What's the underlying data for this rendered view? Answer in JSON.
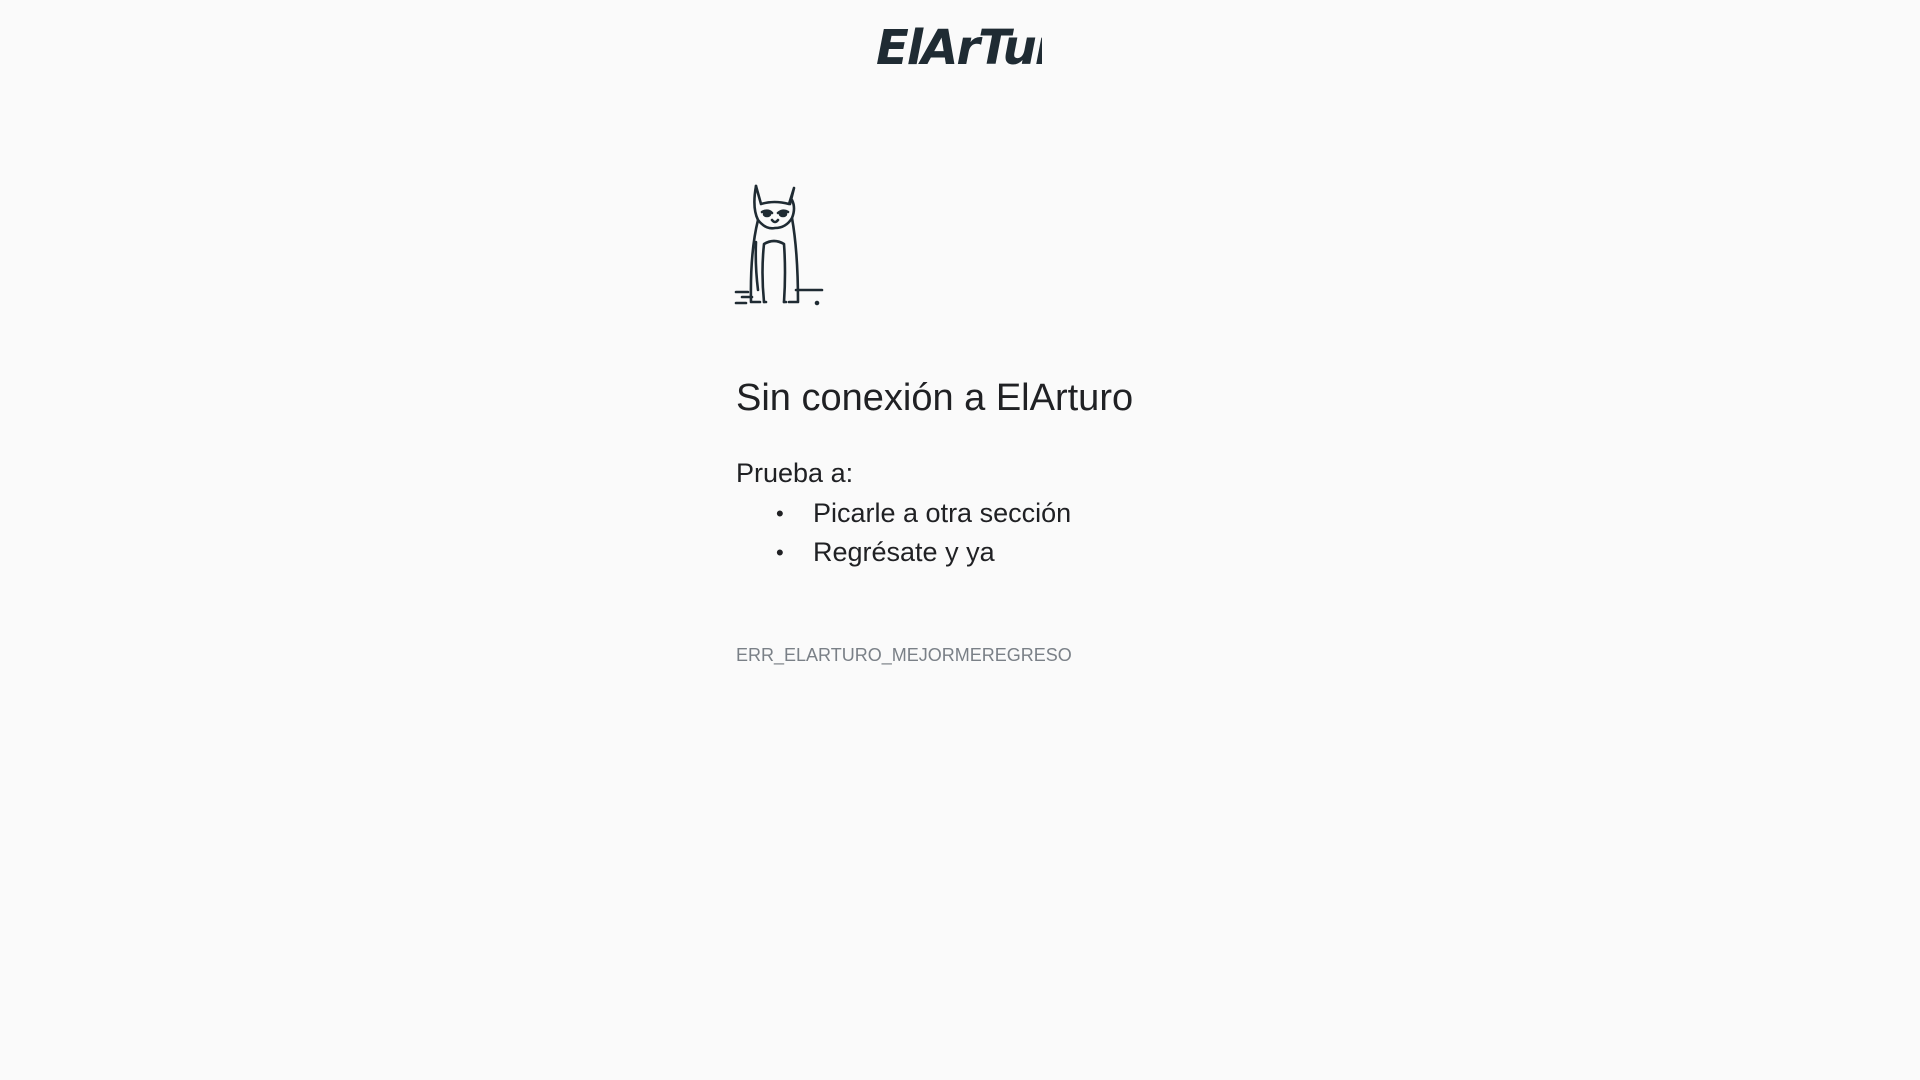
{
  "brand": {
    "logo_text": "ElArTuro"
  },
  "error_page": {
    "illustration": "cat-standing-icon",
    "title": "Sin conexión a ElArturo",
    "suggestions_heading": "Prueba a:",
    "suggestions": [
      "Picarle a otra sección",
      "Regrésate y ya"
    ],
    "bullet": "•",
    "error_code": "ERR_ELARTURO_MEJORMEREGRESO"
  },
  "colors": {
    "background": "#fafafa",
    "text": "#202124",
    "muted": "#7a8087",
    "logo": "#1f2b33"
  }
}
